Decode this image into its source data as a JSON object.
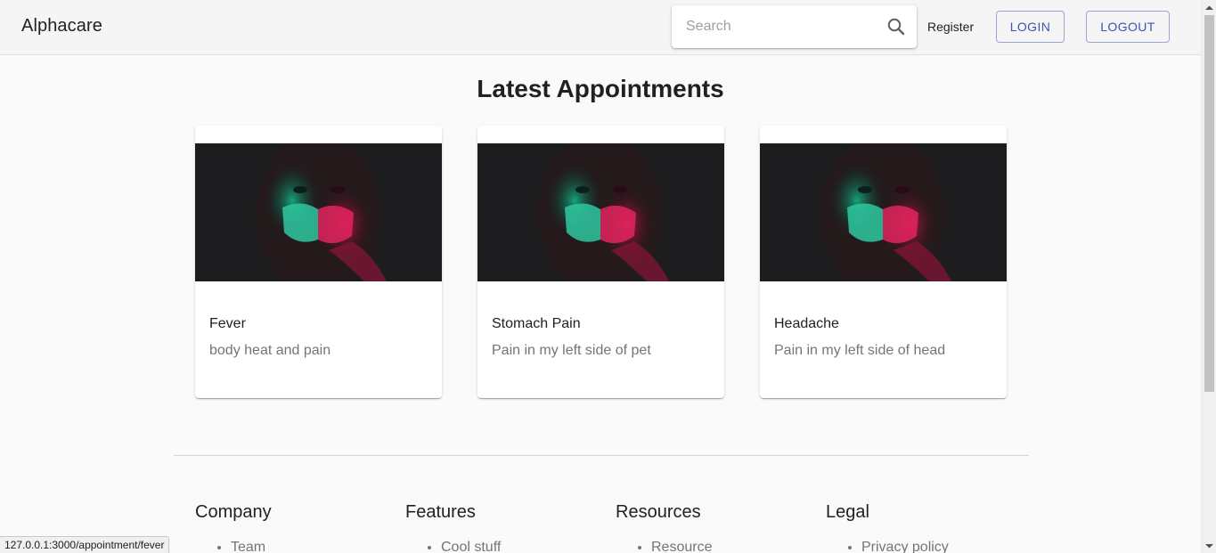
{
  "header": {
    "brand": "Alphacare",
    "search": {
      "placeholder": "Search",
      "value": ""
    },
    "register_label": "Register",
    "login_label": "LOGIN",
    "logout_label": "LOGOUT",
    "accent_color": "#3f51b5"
  },
  "main": {
    "title": "Latest Appointments",
    "cards": [
      {
        "title": "Fever",
        "description": "body heat and pain",
        "image": "masked-person-neon-photo"
      },
      {
        "title": "Stomach Pain",
        "description": "Pain in my left side of pet",
        "image": "masked-person-neon-photo"
      },
      {
        "title": "Headache",
        "description": "Pain in my left side of head",
        "image": "masked-person-neon-photo"
      }
    ]
  },
  "footer": {
    "columns": [
      {
        "heading": "Company",
        "items": [
          "Team"
        ]
      },
      {
        "heading": "Features",
        "items": [
          "Cool stuff"
        ]
      },
      {
        "heading": "Resources",
        "items": [
          "Resource"
        ]
      },
      {
        "heading": "Legal",
        "items": [
          "Privacy policy"
        ]
      }
    ]
  },
  "status_bar": {
    "url": "127.0.0.1:3000/appointment/fever"
  }
}
